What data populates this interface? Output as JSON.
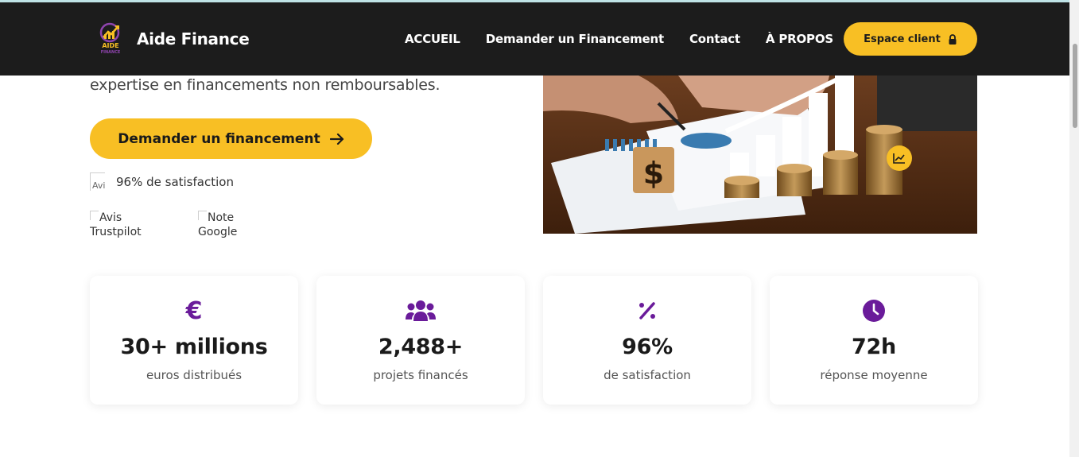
{
  "brand": {
    "name": "Aide Finance",
    "logo_text": "AIDE",
    "logo_subtext": "FINANCE"
  },
  "nav": {
    "items": [
      "ACCUEIL",
      "Demander un Financement",
      "Contact",
      "À PROPOS"
    ],
    "client_button": "Espace client"
  },
  "hero": {
    "text": "expertise en financements non remboursables.",
    "cta_label": "Demander un financement",
    "satisfaction_text": "96% de satisfaction",
    "satisfaction_img_alt": "Avis",
    "badge_trustpilot_alt": "Avis Trustpilot",
    "badge_google_alt": "Note Google"
  },
  "stats": [
    {
      "icon": "euro-icon",
      "value": "30+ millions",
      "label": "euros distribués"
    },
    {
      "icon": "users-icon",
      "value": "2,488+",
      "label": "projets financés"
    },
    {
      "icon": "percent-icon",
      "value": "96%",
      "label": "de satisfaction"
    },
    {
      "icon": "clock-icon",
      "value": "72h",
      "label": "réponse moyenne"
    }
  ],
  "colors": {
    "accent": "#f8bf24",
    "nav_bg": "#1c1c1c",
    "icon_purple": "#6a1b9a"
  }
}
